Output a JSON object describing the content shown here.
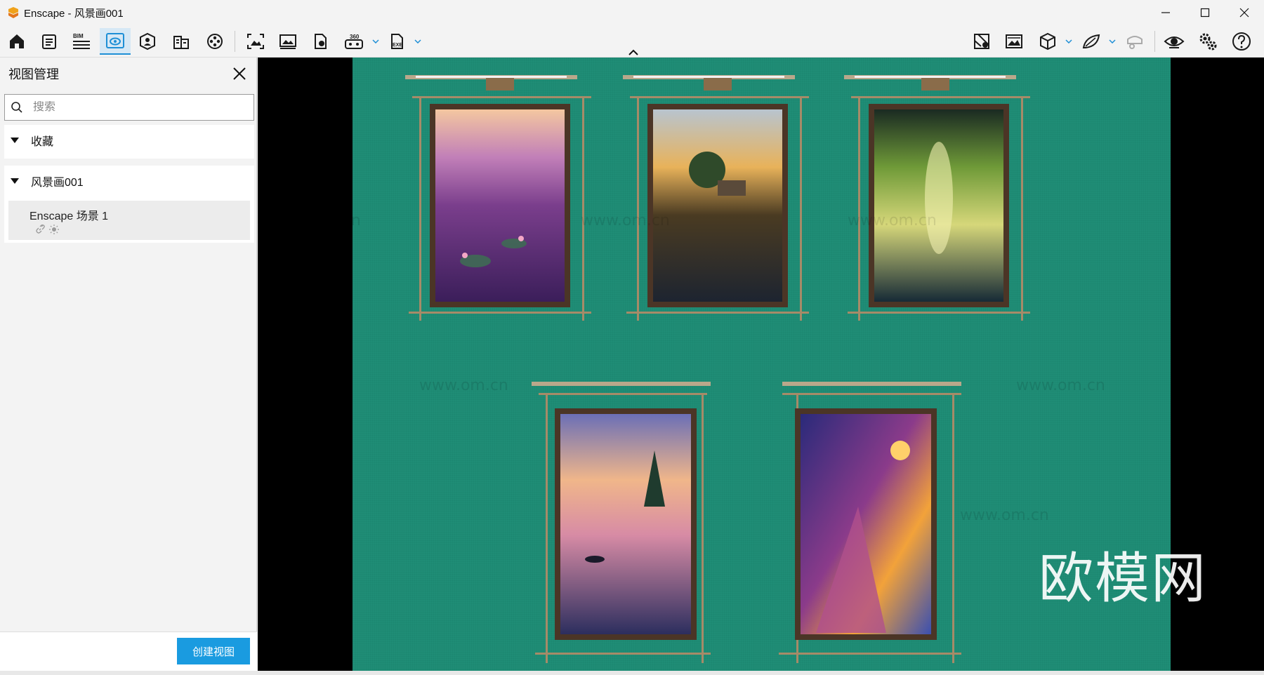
{
  "window": {
    "title": "Enscape - 风景画001",
    "minimize_icon": "minimize-icon",
    "maximize_icon": "maximize-icon",
    "close_icon": "close-icon"
  },
  "toolbar": {
    "left_buttons": [
      "home-icon",
      "notes-icon",
      "bim-icon",
      "views-icon",
      "assets-icon",
      "buildings-icon",
      "video-icon"
    ],
    "middle_buttons": [
      "screenshot-icon",
      "batch-render-icon",
      "upload-icon",
      "panorama-360-icon",
      "export-exe-icon"
    ],
    "right_buttons": [
      "map-icon",
      "image-settings-icon",
      "view-mode-icon",
      "material-icon",
      "vr-headset-icon",
      "visual-settings-icon",
      "settings-icon",
      "help-icon"
    ],
    "bim_label": "BIM",
    "pano_label": "360",
    "exe_label": "EXE"
  },
  "panel": {
    "title": "视图管理",
    "search_placeholder": "搜索",
    "favorites_label": "收藏",
    "project_label": "风景画001",
    "view_item_label": "Enscape 场景 1",
    "create_button": "创建视图"
  },
  "viewport": {
    "wall_color": "#1f8d76",
    "watermark_text": "欧模网",
    "watermark_url": "www.om.cn"
  },
  "paintings": [
    {
      "name": "water-lilies-sunset",
      "description": "purple lake with water lilies at sunset"
    },
    {
      "name": "cottage-lake-sunset",
      "description": "cottage by lake with boat at sunset"
    },
    {
      "name": "forest-light-path",
      "description": "glowing forest path at night"
    },
    {
      "name": "boat-forest-lake",
      "description": "boat on pink lake with pines"
    },
    {
      "name": "cliff-path-sunset",
      "description": "cliffside path by glowing sea"
    }
  ]
}
